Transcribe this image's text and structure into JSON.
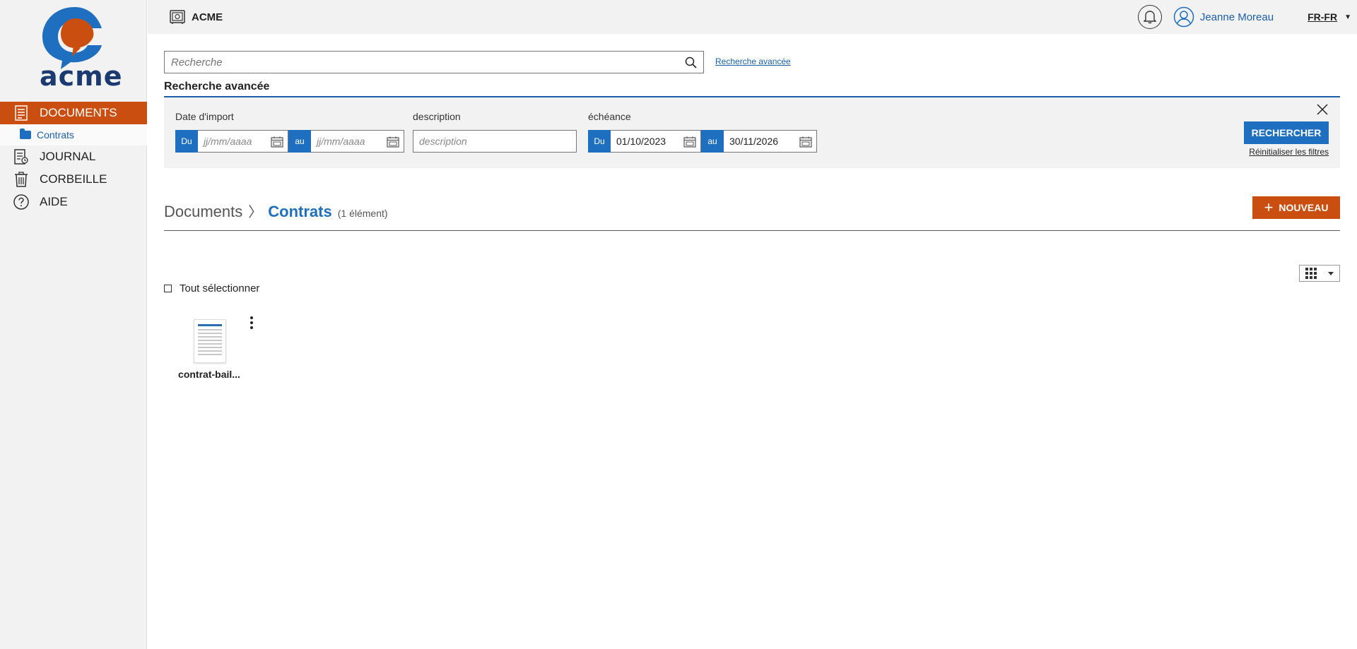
{
  "app": {
    "brand_logo_text": "acme",
    "title": "ACME"
  },
  "header": {
    "user_name": "Jeanne Moreau",
    "language": "FR-FR"
  },
  "sidebar": {
    "items": [
      {
        "label": "DOCUMENTS",
        "icon": "document-list-icon",
        "active": true
      },
      {
        "label": "Contrats",
        "icon": "folder-icon",
        "sub": true
      },
      {
        "label": "JOURNAL",
        "icon": "journal-icon"
      },
      {
        "label": "CORBEILLE",
        "icon": "trash-icon"
      },
      {
        "label": "AIDE",
        "icon": "help-icon"
      }
    ]
  },
  "search": {
    "placeholder": "Recherche",
    "advanced_link": "Recherche avancée"
  },
  "advanced": {
    "title": "Recherche avancée",
    "import_label": "Date d'import",
    "import_from_tag": "Du",
    "import_from_placeholder": "jj/mm/aaaa",
    "import_to_tag": "au",
    "import_to_placeholder": "jj/mm/aaaa",
    "description_label": "description",
    "description_placeholder": "description",
    "due_label": "échéance",
    "due_from_tag": "Du",
    "due_from_value": "01/10/2023",
    "due_to_tag": "au",
    "due_to_value": "30/11/2026",
    "search_button": "RECHERCHER",
    "reset_link": "Réinitialiser les filtres"
  },
  "breadcrumb": {
    "root": "Documents",
    "separator": "〉",
    "current": "Contrats",
    "count": "(1 élément)"
  },
  "toolbar": {
    "new_button": "NOUVEAU"
  },
  "list": {
    "select_all": "Tout sélectionner",
    "documents": [
      {
        "name": "contrat-bail..."
      }
    ]
  },
  "colors": {
    "accent_orange": "#c94e0f",
    "accent_blue": "#1e6fbf",
    "logo_navy": "#1b3a70"
  }
}
